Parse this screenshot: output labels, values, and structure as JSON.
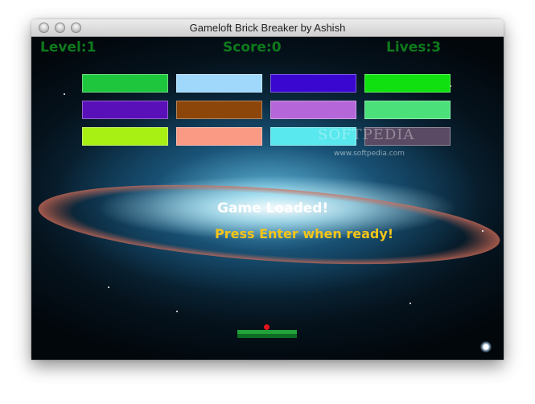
{
  "window": {
    "title": "Gameloft Brick Breaker by Ashish"
  },
  "hud": {
    "level": "Level:1",
    "score": "Score:0",
    "lives": "Lives:3"
  },
  "bricks": {
    "row1": [
      "#1ec63e",
      "#9fd8fa",
      "#3a07d0",
      "#10e00f"
    ],
    "row2": [
      "#5a10b8",
      "#8c4609",
      "#b566d8",
      "#4be07a"
    ],
    "row3": [
      "#a8f013",
      "#fb9a84",
      "#58e8ed",
      "#5a4a63"
    ]
  },
  "watermark": {
    "brand": "SOFTPEDIA",
    "url": "www.softpedia.com"
  },
  "messages": {
    "status": "Game Loaded!",
    "prompt": "Press Enter when ready!"
  },
  "colors": {
    "hud_text": "#0e7a1c",
    "prompt_text": "#f5c518",
    "paddle": "#21a23a",
    "ball": "#e4141c"
  }
}
